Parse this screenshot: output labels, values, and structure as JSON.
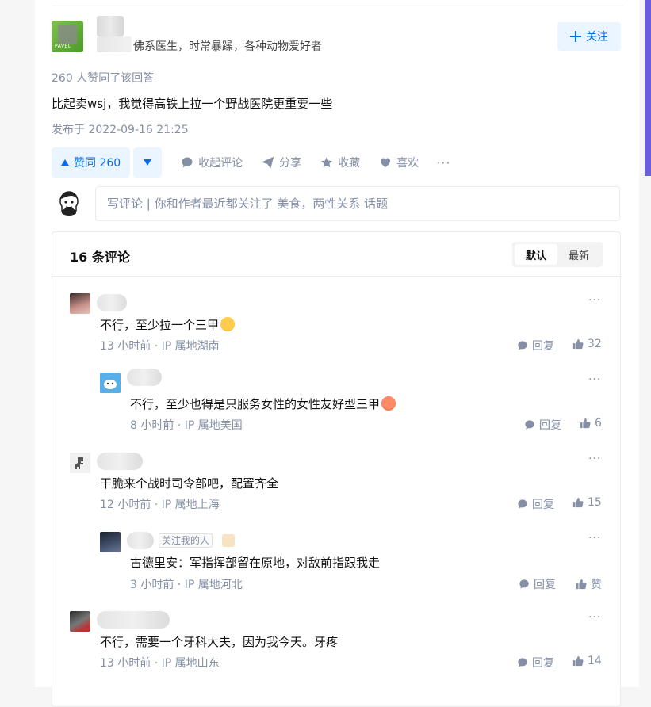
{
  "author": {
    "headline": "佛系医生，时常暴躁，各种动物爱好者",
    "avatar_tag": "PAVEL",
    "follow_label": "关注"
  },
  "answer": {
    "vote_summary": "260 人赞同了该回答",
    "text": "比起卖wsj，我觉得高铁上拉一个野战医院更重要一些",
    "published": "发布于 2022-09-16 21:25"
  },
  "actions": {
    "vote_up_label": "赞同 260",
    "collapse_comments": "收起评论",
    "share": "分享",
    "favorite": "收藏",
    "like": "喜欢",
    "more": "···"
  },
  "composer": {
    "placeholder": "写评论 | 你和作者最近都关注了 美食，两性关系 话题"
  },
  "comments_section": {
    "count_label": "16 条评论",
    "sort_default": "默认",
    "sort_latest": "最新"
  },
  "comments": [
    {
      "text": "不行，至少拉一个三甲",
      "meta": "13 小时前 · IP 属地湖南",
      "reply": "回复",
      "likes": "32",
      "more": "···"
    },
    {
      "text": "不行，至少也得是只服务女性的女性友好型三甲",
      "meta": "8 小时前 · IP 属地美国",
      "reply": "回复",
      "likes": "6",
      "more": "···"
    },
    {
      "text": "干脆来个战时司令部吧，配置齐全",
      "meta": "12 小时前 · IP 属地上海",
      "reply": "回复",
      "likes": "15",
      "more": "···"
    },
    {
      "text": "古德里安：军指挥部留在原地，对敌前指跟我走",
      "meta": "3 小时前 · IP 属地河北",
      "reply": "回复",
      "likes": "赞",
      "badge": "关注我的人",
      "more": "···"
    },
    {
      "text": "不行，需要一个牙科大夫，因为我今天。牙疼",
      "meta": "13 小时前 · IP 属地山东",
      "reply": "回复",
      "likes": "14",
      "more": "···"
    }
  ],
  "colors": {
    "accent": "#056de8",
    "accent_bg": "#ebf5ff",
    "meta_gray": "#8590a6"
  }
}
